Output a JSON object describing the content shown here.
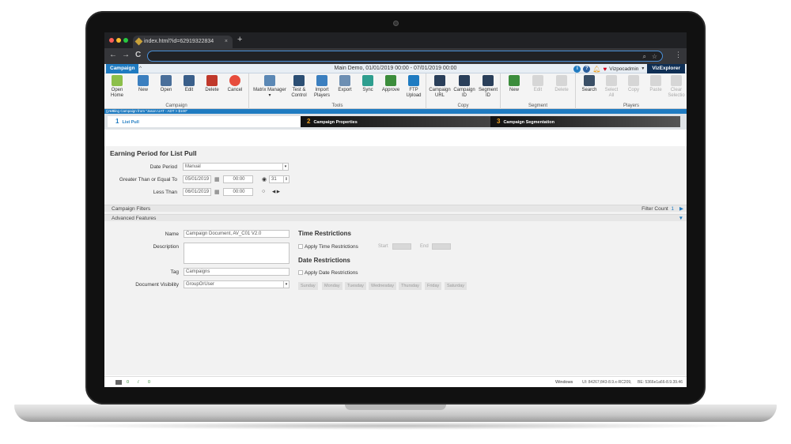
{
  "browser": {
    "tab_title": "index.html?id=62919322834",
    "tab_close": "×",
    "new_tab": "+",
    "back": "←",
    "forward": "→",
    "reload": "C",
    "menu": "⋮"
  },
  "app_header": {
    "module_tab": "Campaign",
    "collapse": "^",
    "title": "Main Demo, 01/01/2019 00:00  -  07/01/2019 00:00",
    "info_icon": "i",
    "help_icon": "?",
    "user": "Vizpocadmin",
    "brand": "VizExplorer"
  },
  "ribbon": {
    "groups": {
      "campaign": "Campaign",
      "tools": "Tools",
      "copy": "Copy",
      "segment": "Segment",
      "players": "Players"
    },
    "buttons": {
      "open_home": "Open\nHome",
      "new": "New",
      "open": "Open",
      "edit": "Edit",
      "delete": "Delete",
      "cancel": "Cancel",
      "matrix_manager": "Matrix Manager",
      "test_control": "Test &\nControl",
      "import_players": "Import\nPlayers",
      "export": "Export",
      "sync": "Sync",
      "approve": "Approve",
      "ftp_upload": "FTP\nUpload",
      "campaign_url": "Campaign\nURL",
      "campaign_id": "Campaign\nID",
      "segment_id": "Segment\nID",
      "seg_new": "New",
      "seg_edit": "Edit",
      "seg_delete": "Delete",
      "search": "Search",
      "select_all": "Select\nAll",
      "copy": "Copy",
      "paste": "Paste",
      "clear_selection": "Clear\nSelectio"
    }
  },
  "dialog": {
    "title": "Creating Campaign from \"Jason UAT - ADT > $100\"",
    "controls": "_ ▫ ×",
    "steps": [
      {
        "num": "1",
        "label": "List Pull"
      },
      {
        "num": "2",
        "label": "Campaign Properties"
      },
      {
        "num": "3",
        "label": "Campaign Segmentation"
      }
    ]
  },
  "earning": {
    "title": "Earning Period for List Pull",
    "date_period_label": "Date Period",
    "date_period_value": "Manual",
    "gte_label": "Greater Than or Equal To",
    "gte_date": "05/01/2019",
    "gte_time": "00:00",
    "days_value": "31",
    "lt_label": "Less Than",
    "lt_date": "06/01/2019",
    "lt_time": "00:00",
    "arrows": "◀ ▶"
  },
  "campaign_filters": {
    "label": "Campaign Filters",
    "filter_count_label": "Filter Count",
    "filter_count": "1"
  },
  "advanced": {
    "label": "Advanced Features",
    "name_label": "Name",
    "name_value": "Campaign Document, AV_C01 V2.0",
    "description_label": "Description",
    "tag_label": "Tag",
    "tag_value": "Campaigns",
    "visibility_label": "Document Visibility",
    "visibility_value": "GroupOrUser",
    "time_restrictions": "Time Restrictions",
    "apply_time": "Apply Time Restrictions",
    "start_label": "Start",
    "end_label": "End",
    "date_restrictions": "Date Restrictions",
    "apply_date": "Apply Date Restrictions",
    "days": [
      "Sunday",
      "Monday",
      "Tuesday",
      "Wednesday",
      "Thursday",
      "Friday",
      "Saturday"
    ]
  },
  "status": {
    "count_a": "0",
    "sep": "/",
    "count_b": "0",
    "platform": "Windows",
    "ui_version": "UI: 84267;843-8.9.x-RC209,",
    "be_version": "BE: 5366e1a66-8.9.39.46"
  },
  "colors": {
    "accent": "#1f7bc1",
    "step_active": "#ffffff",
    "step_dark": "#222222",
    "step_num": "#f0a020"
  }
}
